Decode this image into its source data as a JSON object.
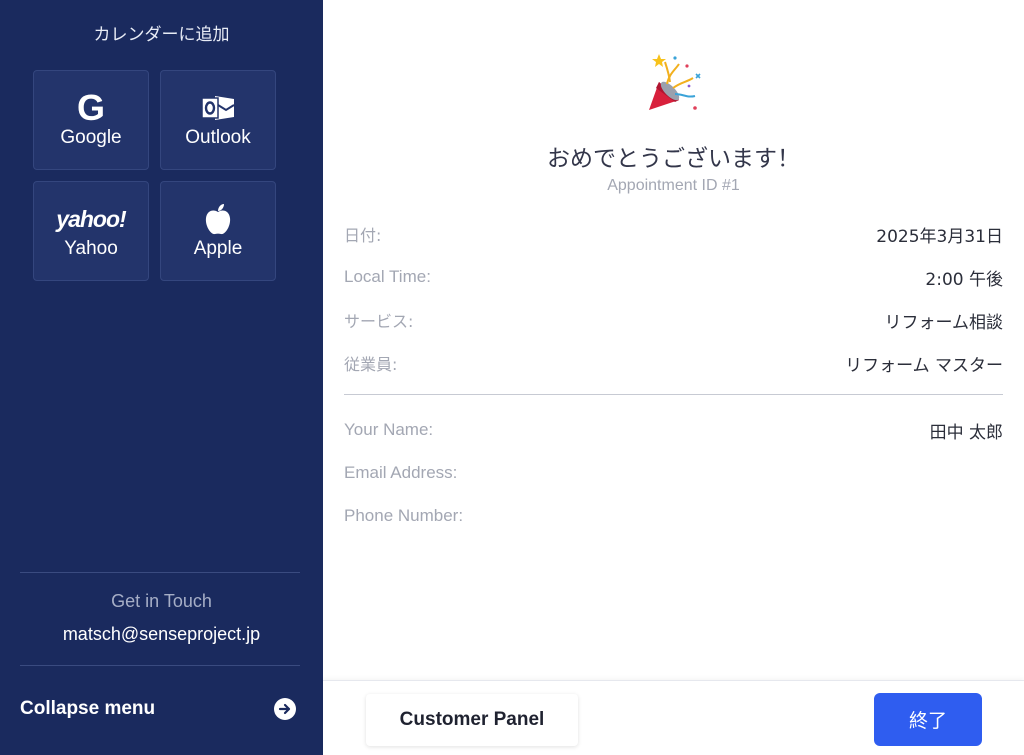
{
  "sidebar": {
    "title": "カレンダーに追加",
    "calendar_buttons": [
      {
        "label": "Google",
        "icon": "google-icon"
      },
      {
        "label": "Outlook",
        "icon": "outlook-icon"
      },
      {
        "label": "Yahoo",
        "icon": "yahoo-icon",
        "logo_text": "yahoo!"
      },
      {
        "label": "Apple",
        "icon": "apple-icon"
      }
    ],
    "get_in_touch": "Get in Touch",
    "contact_email": "matsch@senseproject.jp",
    "collapse_label": "Collapse menu",
    "colors": {
      "background": "#1a2a5e",
      "button_bg": "#23346b"
    }
  },
  "main": {
    "heading": "おめでとうございます！",
    "appointment_id": "Appointment ID #1",
    "details": [
      {
        "key": "日付:",
        "value": "2025年3月31日"
      },
      {
        "key": "Local Time:",
        "value": "2:00 午後"
      },
      {
        "key": "サービス:",
        "value": "リフォーム相談"
      },
      {
        "key": "従業員:",
        "value": "リフォーム マスター"
      }
    ],
    "customer": [
      {
        "key": "Your Name:",
        "value": "田中 太郎"
      },
      {
        "key": "Email Address:",
        "value": ""
      },
      {
        "key": "Phone Number:",
        "value": ""
      }
    ]
  },
  "footer": {
    "customer_panel_label": "Customer Panel",
    "finish_label": "終了",
    "colors": {
      "accent": "#2f5df0"
    }
  }
}
